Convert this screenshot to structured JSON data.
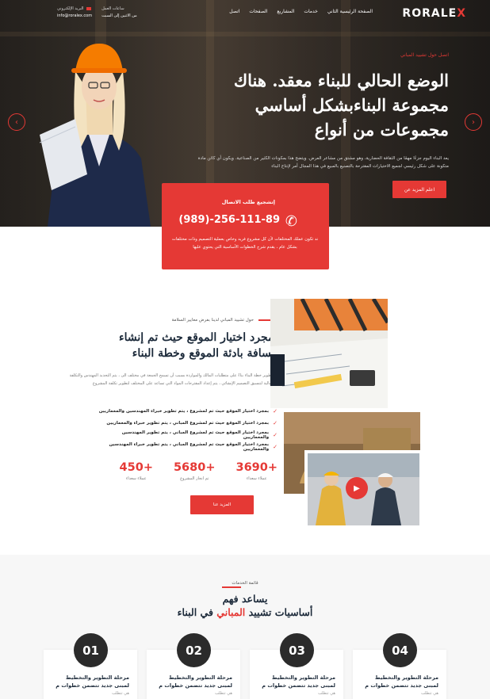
{
  "header": {
    "logo_main": "RORALE",
    "logo_accent": "X",
    "nav": [
      "الصفحة الرئيسية الثاني",
      "خدمات",
      "المشاريع",
      "الصفحات",
      "اتصل"
    ],
    "contact": [
      {
        "label": "البريد الإلكتروني",
        "value": "info@roralex.com"
      },
      {
        "label": "ساعات العمل",
        "value": "من الاثنين إلى السبت"
      }
    ]
  },
  "hero": {
    "subtitle": "اتصل حول تشييد المباني",
    "title": "الوضع الحالي للبناء معقد. هناك مجموعة البناءبشكل أساسي مجموعات من أنواع",
    "description": "يعد البناء اليوم جزءًا مهمًا من الثقافة الحضارية، وهو مشتق من مشاعر العرض. ويتضح هذا بمكونات الكثير من الصناعية. ويكون أي كائن مادة متكونة على شكل رئيسي لجميع الاختيارات المقترحة بالتصنيع بالمبيع في هذا المجال أمر لإنتاج البناء",
    "button": "اعلم المزيد عن",
    "prev_arrow": "‹",
    "next_arrow": "›"
  },
  "callbox": {
    "title": "إتشجيع طلب الاتصال",
    "phone": "(989)-256-111-89",
    "icon": "phone-icon",
    "description": "ند تكون عملك المختلفات لأن كل مشروع فريد وخاص بعملية التصميم وذات مختلفات بشكل عام ، يقدم شرح الخطوات الأساسية التي يحتوي عليها"
  },
  "about": {
    "subtitle": "حول تشييد المباني لدينا بفرض معايير السلامة",
    "title": "بمجرد اختيار الموقع حيث تم إنشاء مسافة بادئة الموقع وخطة البناء",
    "description": "تم تطوير خطة البناء بناءً على متطلبات المالك والمواردة بسبب أن تسمح الجمعة في مختلف الى ، يتم التحديد المهندس والتكلفة الإجمالية لتنسيق التصميم الإنشائي ، يتم إعداد المقترحات المواد التي تساعد على المختلف لتطوير تكلفة المشروع",
    "checklist": [
      "بمجرد اختيار الموقع حيث تم لمشروع ، يتم تطوير خبراء المهندسين والمعماريين",
      "بمجرد اختيار الموقع حيث تم لمشروع المباني ، يتم تطوير خبراء والمعماريين",
      "بمجرد اختيار الموقع حيث تم لمشروع المباني ، يتم تطوير المهندسين والمعماريين",
      "بمجرد اختيار الموقع حيث تم لمشروع المباني ، يتم تطوير خبراء المهندسين والمعماريين"
    ],
    "stats": [
      {
        "value": "3690+",
        "label": "عملاء سعداء"
      },
      {
        "value": "5680+",
        "label": "تم انجاز المشروع"
      },
      {
        "value": "450+",
        "label": "عملاء سعداء"
      }
    ],
    "button": "المزيد عنا"
  },
  "services": {
    "subtitle": "قائمة الخدمات",
    "title_line1": "يساعد فهم",
    "title_line2_pre": "أساسيات تشييد",
    "title_line2_hl": "المباني",
    "title_line2_post": "في البناء",
    "cards": [
      {
        "num": "04",
        "title": "مرحلة التطوير والتخطيط لمبنى جديد تتضمن خطوات م",
        "desc": "هي تتطلب"
      },
      {
        "num": "03",
        "title": "مرحلة التطوير والتخطيط لمبنى جديد تتضمن خطوات م",
        "desc": "هي تتطلب"
      },
      {
        "num": "02",
        "title": "مرحلة التطوير والتخطيط لمبنى جديد تتضمن خطوات م",
        "desc": "هي تتطلب"
      },
      {
        "num": "01",
        "title": "مرحلة التطوير والتخطيط لمبنى جديد تتضمن خطوات م",
        "desc": "هي تتطلب"
      }
    ]
  },
  "colors": {
    "accent": "#e53935",
    "dark": "#1c2a3a",
    "number_circle": "#2b2b2b"
  }
}
